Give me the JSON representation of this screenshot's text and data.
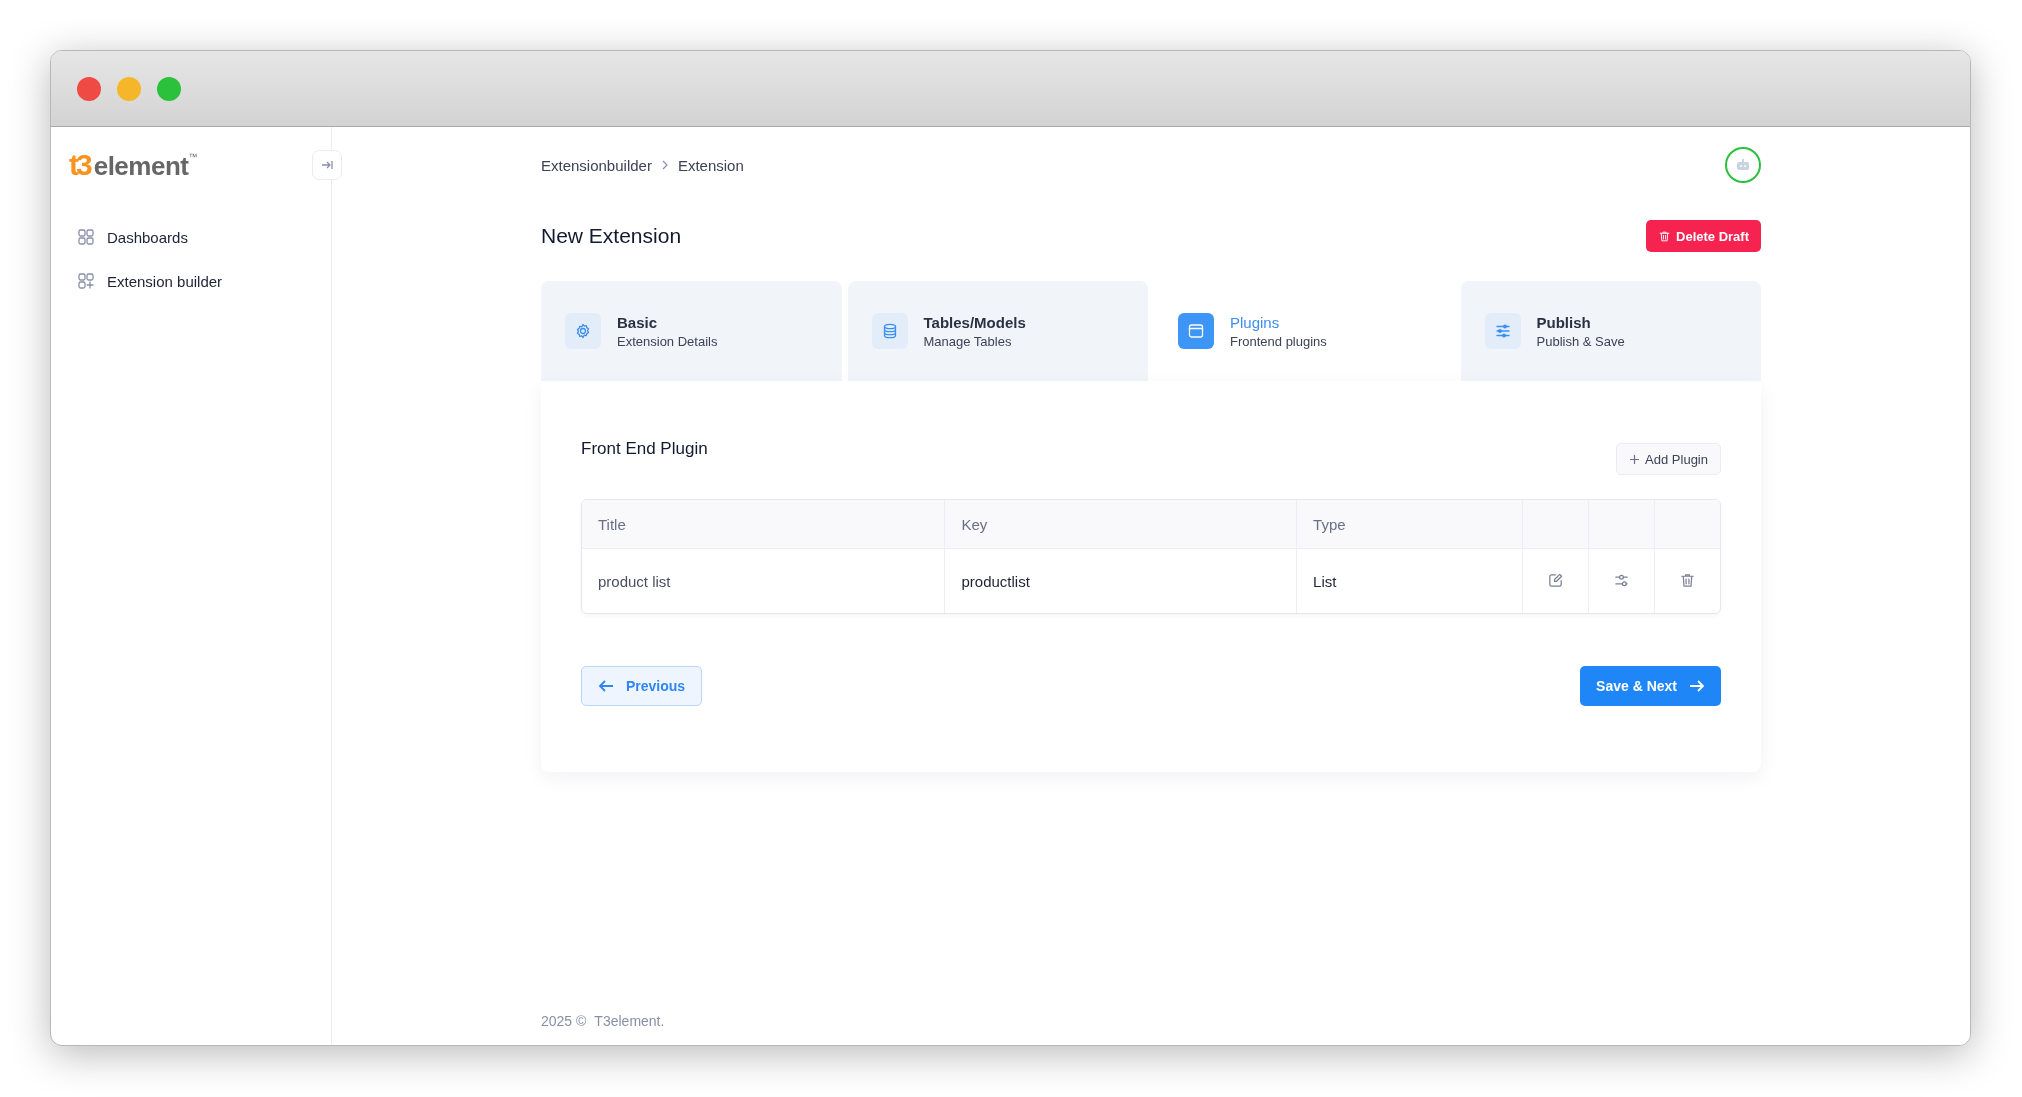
{
  "logo": {
    "mark": "t3",
    "text": "element",
    "trademark": "™"
  },
  "sidebar": {
    "items": [
      {
        "label": "Dashboards",
        "selected": false
      },
      {
        "label": "Extension builder",
        "selected": false
      }
    ]
  },
  "breadcrumb": [
    "Extensionbuilder",
    "Extension"
  ],
  "page_title": "New Extension",
  "delete_button": "Delete Draft",
  "steps": [
    {
      "title": "Basic",
      "subtitle": "Extension Details",
      "selected": false
    },
    {
      "title": "Tables/Models",
      "subtitle": "Manage Tables",
      "selected": false
    },
    {
      "title": "Plugins",
      "subtitle": "Frontend plugins",
      "selected": true
    },
    {
      "title": "Publish",
      "subtitle": "Publish & Save",
      "selected": false
    }
  ],
  "section_title": "Front End Plugin",
  "add_button": "Add Plugin",
  "table": {
    "columns": [
      "Title",
      "Key",
      "Type"
    ],
    "rows": [
      {
        "cells": [
          "product list",
          "productlist",
          "List"
        ]
      }
    ]
  },
  "previous_button": "Previous",
  "next_button": "Save & Next",
  "footer": {
    "year": "2025 ©",
    "company": "T3element."
  }
}
